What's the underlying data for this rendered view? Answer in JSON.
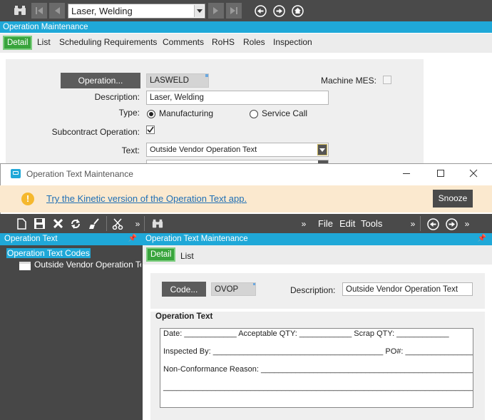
{
  "main_window": {
    "record_select": "Laser, Welding",
    "title": "Operation Maintenance",
    "tabs": [
      "Detail",
      "List",
      "Scheduling Requirements",
      "Comments",
      "RoHS",
      "Roles",
      "Inspection"
    ],
    "form": {
      "operation_button": "Operation...",
      "operation_value": "LASWELD",
      "machine_mes_label": "Machine MES:",
      "description_label": "Description:",
      "description_value": "Laser, Welding",
      "type_label": "Type:",
      "type_options": [
        "Manufacturing",
        "Service Call"
      ],
      "type_selected": "Manufacturing",
      "subcontract_label": "Subcontract Operation:",
      "subcontract_checked": true,
      "text_label": "Text:",
      "text_value": "Outside Vendor Operation Text"
    }
  },
  "text_window": {
    "title": "Operation Text Maintenance",
    "banner": {
      "message": "Try the Kinetic version of the Operation Text app.",
      "snooze_label": "Snooze"
    },
    "menu": [
      "File",
      "Edit",
      "Tools"
    ],
    "left_panel": {
      "title": "Operation Text",
      "root": "Operation Text Codes",
      "child": "Outside Vendor Operation Te"
    },
    "right_panel": {
      "title": "Operation Text Maintenance",
      "tabs": [
        "Detail",
        "List"
      ],
      "code_button": "Code...",
      "code_value": "OVOP",
      "description_label": "Description:",
      "description_value": "Outside Vendor Operation Text",
      "operation_text_label": "Operation Text",
      "text_lines": [
        "Date: ____________ Acceptable QTY: ____________ Scrap QTY: ____________",
        "Inspected By: _______________________________________ PO#: ________________",
        "Non-Conformance Reason: ____________________________________________________",
        "_________________________________________________________________________"
      ]
    }
  },
  "colors": {
    "accent_blue": "#1fa8d8",
    "tab_green": "#38a43c",
    "toolbar_dark": "#4a4a4a",
    "banner_bg": "#fbe9cf",
    "warning_icon": "#f5b82e"
  }
}
